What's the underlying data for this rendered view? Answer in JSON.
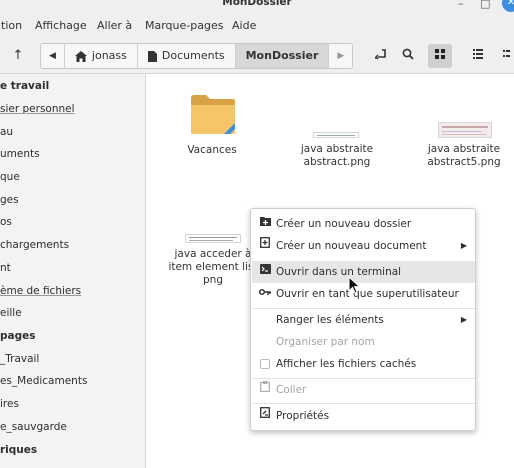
{
  "window": {
    "title": "MonDossier",
    "minimize": "–",
    "maximize": "□",
    "close": "✕"
  },
  "menu": [
    "ition",
    "Affichage",
    "Aller à",
    "Marque-pages",
    "Aide"
  ],
  "toolbar": {
    "up_icon": "↑",
    "back_icon": "◀",
    "forward_icon": "▶",
    "crumbs": [
      "jonass",
      "Documents",
      "MonDossier"
    ],
    "terminal_icon": "⤾",
    "search_icon": "🔍",
    "grid_icon": "▦",
    "list_icon": "☰",
    "compact_icon": "⋮⋮"
  },
  "sidebar": {
    "items": [
      {
        "label": "e travail",
        "kind": "head"
      },
      {
        "label": "sier personnel",
        "kind": "uline"
      },
      {
        "label": "au",
        "kind": "item"
      },
      {
        "label": "uments",
        "kind": "item"
      },
      {
        "label": "que",
        "kind": "item"
      },
      {
        "label": "ges",
        "kind": "item"
      },
      {
        "label": "os",
        "kind": "item"
      },
      {
        "label": "chargements",
        "kind": "item"
      },
      {
        "label": "nt",
        "kind": "item"
      },
      {
        "label": "ème de fichiers",
        "kind": "uline"
      },
      {
        "label": "eille",
        "kind": "item"
      },
      {
        "label": "pages",
        "kind": "head"
      },
      {
        "label": "_Travail",
        "kind": "item"
      },
      {
        "label": "es_Medicaments",
        "kind": "item"
      },
      {
        "label": "ires",
        "kind": "item"
      },
      {
        "label": "e_sauvgarde",
        "kind": "item"
      },
      {
        "label": "riques",
        "kind": "head"
      }
    ]
  },
  "files": [
    {
      "name": "Vacances",
      "type": "folder"
    },
    {
      "name_line1": "java abstraite",
      "name_line2": "abstract.png",
      "type": "image"
    },
    {
      "name_line1": "java abstraite",
      "name_line2": "abstract5.png",
      "type": "image"
    },
    {
      "name_line1": "java acceder à",
      "name_line2": "item element list",
      "name_line3": "png",
      "type": "image"
    }
  ],
  "colors": {
    "folder": "#f6c567",
    "folder_tab": "#d9a244",
    "accent": "#3d8de0",
    "hover": "#e6e6e6"
  },
  "context_menu": {
    "items": [
      {
        "label": "Créer un nouveau dossier",
        "icon": "folder-plus-icon"
      },
      {
        "label": "Créer un nouveau document",
        "icon": "document-plus-icon",
        "submenu": true
      },
      {
        "label": "Ouvrir dans un terminal",
        "icon": "terminal-icon",
        "hover": true
      },
      {
        "label": "Ouvrir en tant que superutilisateur",
        "icon": "key-icon"
      },
      {
        "label": "Ranger les éléments",
        "submenu": true
      },
      {
        "label": "Organiser par nom",
        "disabled": true
      },
      {
        "label": "Afficher les fichiers cachés",
        "checkbox": true
      },
      {
        "label": "Coller",
        "icon": "clipboard-icon",
        "disabled": true
      },
      {
        "label": "Propriétés",
        "icon": "properties-icon"
      }
    ]
  }
}
